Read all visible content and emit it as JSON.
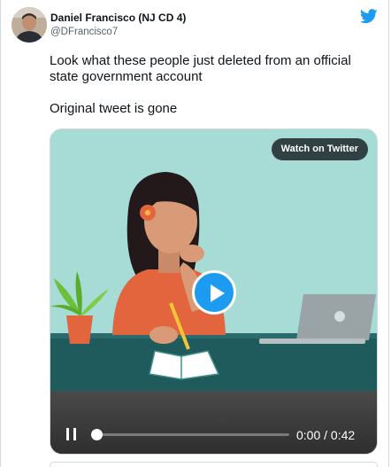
{
  "author": {
    "name": "Daniel Francisco (NJ CD 4)",
    "handle": "@DFrancisco7",
    "avatar_icon": "profile-photo"
  },
  "brand": {
    "icon": "twitter-bird-icon",
    "color": "#1d9bf0"
  },
  "tweet": {
    "paragraphs": [
      "Look what these people just deleted from an official state government account",
      "Original tweet is gone"
    ]
  },
  "video": {
    "watch_label": "Watch on Twitter",
    "current_time": "0:00",
    "separator": "/",
    "duration": "0:42",
    "progress": 0,
    "play_icon": "play-icon",
    "pause_icon": "pause-icon"
  }
}
